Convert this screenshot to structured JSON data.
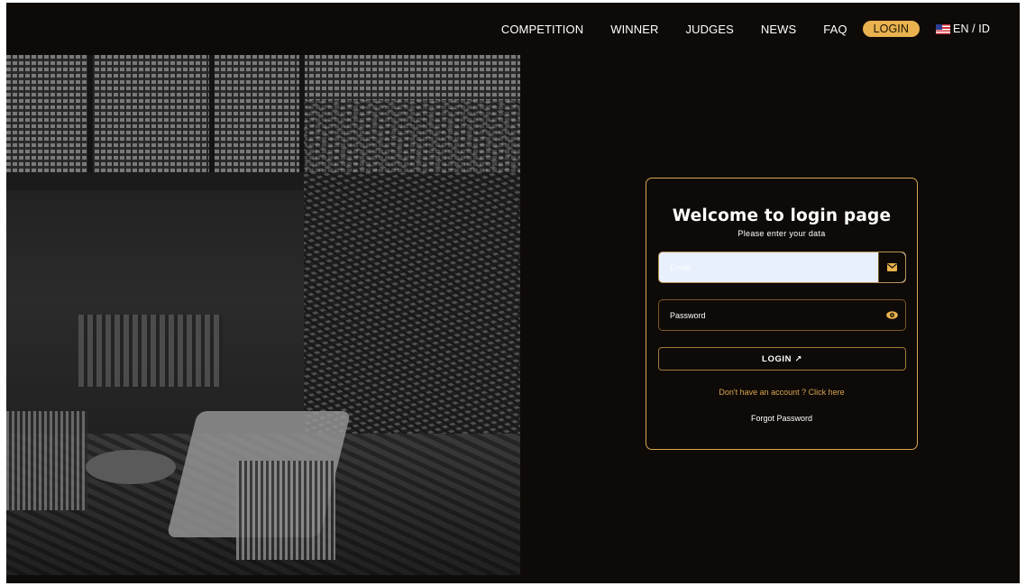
{
  "nav": {
    "items": [
      "COMPETITION",
      "WINNER",
      "JUDGES",
      "NEWS",
      "FAQ"
    ],
    "login_label": "LOGIN",
    "lang_label": "EN / ID",
    "login_color": "#e9b24f"
  },
  "login": {
    "title": "Welcome to login page",
    "subtitle": "Please enter your data",
    "email_placeholder": "Email",
    "password_placeholder": "Password",
    "email_icon": "envelope-icon",
    "password_icon": "eye-icon",
    "button_label": "LOGIN ↗",
    "signup_link": "Don't have an account ? Click here",
    "forgot_link": "Forgot Password",
    "accent_color": "#d9a552",
    "background_color": "#0e0a07"
  }
}
